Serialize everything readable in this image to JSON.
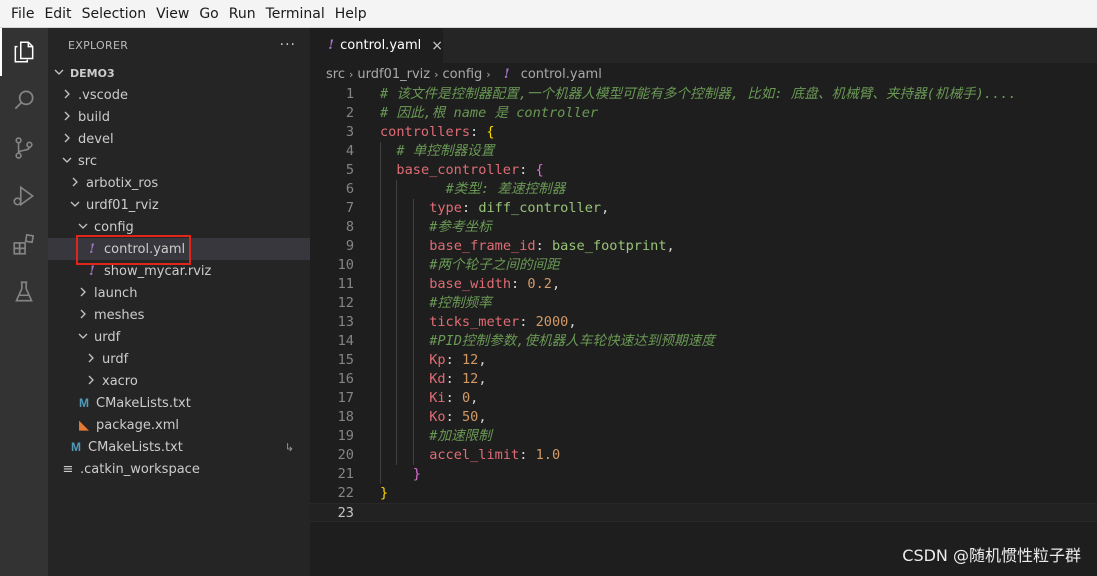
{
  "menubar": {
    "items": [
      "File",
      "Edit",
      "Selection",
      "View",
      "Go",
      "Run",
      "Terminal",
      "Help"
    ]
  },
  "activitybar": {
    "icons": [
      "files-icon",
      "search-icon",
      "source-control-icon",
      "run-debug-icon",
      "extensions-icon",
      "testing-icon"
    ]
  },
  "explorer": {
    "title": "EXPLORER",
    "more": "···",
    "root": "DEMO3",
    "tree": [
      {
        "label": ".vscode",
        "kind": "folder",
        "open": false,
        "depth": 1
      },
      {
        "label": "build",
        "kind": "folder",
        "open": false,
        "depth": 1
      },
      {
        "label": "devel",
        "kind": "folder",
        "open": false,
        "depth": 1
      },
      {
        "label": "src",
        "kind": "folder",
        "open": true,
        "depth": 1
      },
      {
        "label": "arbotix_ros",
        "kind": "folder",
        "open": false,
        "depth": 2
      },
      {
        "label": "urdf01_rviz",
        "kind": "folder",
        "open": true,
        "depth": 2
      },
      {
        "label": "config",
        "kind": "folder",
        "open": true,
        "depth": 3
      },
      {
        "label": "control.yaml",
        "kind": "yaml",
        "depth": 4,
        "selected": true
      },
      {
        "label": "show_mycar.rviz",
        "kind": "yaml",
        "depth": 4
      },
      {
        "label": "launch",
        "kind": "folder",
        "open": false,
        "depth": 3
      },
      {
        "label": "meshes",
        "kind": "folder",
        "open": false,
        "depth": 3
      },
      {
        "label": "urdf",
        "kind": "folder",
        "open": true,
        "depth": 3
      },
      {
        "label": "urdf",
        "kind": "folder",
        "open": false,
        "depth": 4
      },
      {
        "label": "xacro",
        "kind": "folder",
        "open": false,
        "depth": 4
      },
      {
        "label": "CMakeLists.txt",
        "kind": "cmake",
        "depth": 3
      },
      {
        "label": "package.xml",
        "kind": "rss",
        "depth": 3
      },
      {
        "label": "CMakeLists.txt",
        "kind": "cmake",
        "depth": 2,
        "symlink": "↳"
      },
      {
        "label": ".catkin_workspace",
        "kind": "plain",
        "depth": 1
      }
    ]
  },
  "editor": {
    "tab": {
      "label": "control.yaml",
      "close": "×",
      "icon": "!"
    },
    "breadcrumb": [
      "src",
      "urdf01_rviz",
      "config",
      "control.yaml"
    ],
    "breadcrumb_icon": "!",
    "current_line": 23,
    "lines": [
      {
        "n": "1",
        "indent": 0,
        "parts": [
          {
            "t": "# 该文件是控制器配置,一个机器人模型可能有多个控制器, 比如: 底盘、机械臂、夹持器(机械手)....",
            "c": "cmt"
          }
        ]
      },
      {
        "n": "2",
        "indent": 0,
        "parts": [
          {
            "t": "# 因此,根 name 是 controller",
            "c": "cmt"
          }
        ]
      },
      {
        "n": "3",
        "indent": 0,
        "parts": [
          {
            "t": "controllers",
            "c": "key"
          },
          {
            "t": ": ",
            "c": "punc"
          },
          {
            "t": "{",
            "c": "br1"
          }
        ]
      },
      {
        "n": "4",
        "indent": 2,
        "parts": [
          {
            "t": "# 单控制器设置",
            "c": "cmt"
          }
        ]
      },
      {
        "n": "5",
        "indent": 2,
        "parts": [
          {
            "t": "base_controller",
            "c": "key"
          },
          {
            "t": ": ",
            "c": "punc"
          },
          {
            "t": "{",
            "c": "br2"
          }
        ]
      },
      {
        "n": "6",
        "indent": 8,
        "parts": [
          {
            "t": "#类型: 差速控制器",
            "c": "cmt"
          }
        ]
      },
      {
        "n": "7",
        "indent": 6,
        "parts": [
          {
            "t": "type",
            "c": "key"
          },
          {
            "t": ": ",
            "c": "punc"
          },
          {
            "t": "diff_controller",
            "c": "str"
          },
          {
            "t": ",",
            "c": "punc"
          }
        ]
      },
      {
        "n": "8",
        "indent": 6,
        "parts": [
          {
            "t": "#参考坐标",
            "c": "cmt"
          }
        ]
      },
      {
        "n": "9",
        "indent": 6,
        "parts": [
          {
            "t": "base_frame_id",
            "c": "key"
          },
          {
            "t": ": ",
            "c": "punc"
          },
          {
            "t": "base_footprint",
            "c": "str"
          },
          {
            "t": ",",
            "c": "punc"
          }
        ]
      },
      {
        "n": "10",
        "indent": 6,
        "parts": [
          {
            "t": "#两个轮子之间的间距",
            "c": "cmt"
          }
        ]
      },
      {
        "n": "11",
        "indent": 6,
        "parts": [
          {
            "t": "base_width",
            "c": "key"
          },
          {
            "t": ": ",
            "c": "punc"
          },
          {
            "t": "0.2",
            "c": "num"
          },
          {
            "t": ",",
            "c": "punc"
          }
        ]
      },
      {
        "n": "12",
        "indent": 6,
        "parts": [
          {
            "t": "#控制频率",
            "c": "cmt"
          }
        ]
      },
      {
        "n": "13",
        "indent": 6,
        "parts": [
          {
            "t": "ticks_meter",
            "c": "key"
          },
          {
            "t": ": ",
            "c": "punc"
          },
          {
            "t": "2000",
            "c": "num"
          },
          {
            "t": ",",
            "c": "punc"
          }
        ]
      },
      {
        "n": "14",
        "indent": 6,
        "parts": [
          {
            "t": "#PID控制参数,使机器人车轮快速达到预期速度",
            "c": "cmt"
          }
        ]
      },
      {
        "n": "15",
        "indent": 6,
        "parts": [
          {
            "t": "Kp",
            "c": "key"
          },
          {
            "t": ": ",
            "c": "punc"
          },
          {
            "t": "12",
            "c": "num"
          },
          {
            "t": ",",
            "c": "punc"
          }
        ]
      },
      {
        "n": "16",
        "indent": 6,
        "parts": [
          {
            "t": "Kd",
            "c": "key"
          },
          {
            "t": ": ",
            "c": "punc"
          },
          {
            "t": "12",
            "c": "num"
          },
          {
            "t": ",",
            "c": "punc"
          }
        ]
      },
      {
        "n": "17",
        "indent": 6,
        "parts": [
          {
            "t": "Ki",
            "c": "key"
          },
          {
            "t": ": ",
            "c": "punc"
          },
          {
            "t": "0",
            "c": "num"
          },
          {
            "t": ",",
            "c": "punc"
          }
        ]
      },
      {
        "n": "18",
        "indent": 6,
        "parts": [
          {
            "t": "Ko",
            "c": "key"
          },
          {
            "t": ": ",
            "c": "punc"
          },
          {
            "t": "50",
            "c": "num"
          },
          {
            "t": ",",
            "c": "punc"
          }
        ]
      },
      {
        "n": "19",
        "indent": 6,
        "parts": [
          {
            "t": "#加速限制",
            "c": "cmt"
          }
        ]
      },
      {
        "n": "20",
        "indent": 6,
        "parts": [
          {
            "t": "accel_limit",
            "c": "key"
          },
          {
            "t": ": ",
            "c": "punc"
          },
          {
            "t": "1.0",
            "c": "num"
          }
        ]
      },
      {
        "n": "21",
        "indent": 4,
        "parts": [
          {
            "t": "}",
            "c": "br2"
          }
        ]
      },
      {
        "n": "22",
        "indent": 0,
        "parts": [
          {
            "t": "}",
            "c": "br1"
          }
        ]
      },
      {
        "n": "23",
        "indent": 0,
        "parts": []
      }
    ]
  },
  "watermark": "CSDN @随机惯性粒子群",
  "colors": {
    "selection_box": "#e0261b",
    "yaml_icon": "#a074c4",
    "cmake_icon": "#519aba",
    "xml_icon": "#e37933",
    "comment": "#6a9955",
    "key": "#e06c75",
    "string": "#98c379",
    "number": "#d19a66"
  }
}
